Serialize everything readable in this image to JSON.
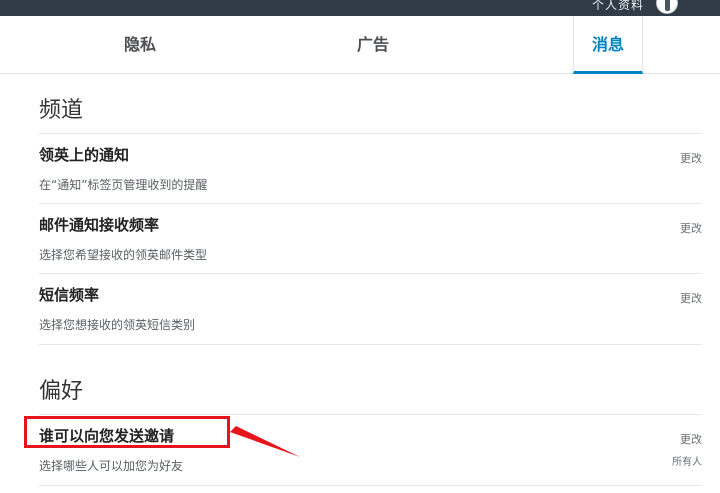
{
  "topbar": {
    "user_text": "个人资料"
  },
  "tabs": [
    {
      "label": "隐私"
    },
    {
      "label": "广告"
    },
    {
      "label": "消息"
    }
  ],
  "channels": {
    "title": "频道",
    "rows": [
      {
        "title": "领英上的通知",
        "desc": "在“通知”标签页管理收到的提醒",
        "action": "更改"
      },
      {
        "title": "邮件通知接收频率",
        "desc": "选择您希望接收的领英邮件类型",
        "action": "更改"
      },
      {
        "title": "短信频率",
        "desc": "选择您想接收的领英短信类别",
        "action": "更改"
      }
    ]
  },
  "preferences": {
    "title": "偏好",
    "rows": [
      {
        "title": "谁可以向您发送邀请",
        "desc": "选择哪些人可以加您为好友",
        "action": "更改",
        "value": "所有人"
      }
    ]
  },
  "colors": {
    "accent": "#0084bf",
    "annotation": "#e8141c",
    "topbar": "#2f3c47"
  }
}
